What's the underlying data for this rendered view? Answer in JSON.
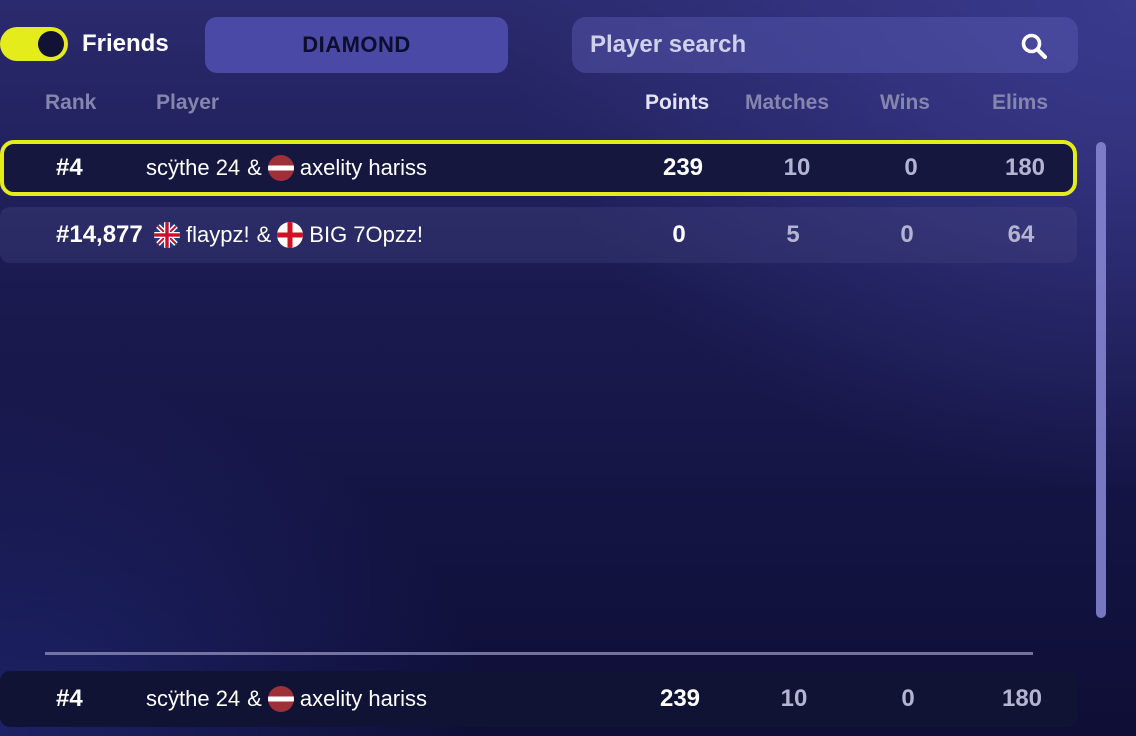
{
  "filters": {
    "friends_label": "Friends",
    "friends_toggle_on": true,
    "tier_label": "DIAMOND",
    "search_placeholder": "Player search"
  },
  "columns": {
    "rank": "Rank",
    "player": "Player",
    "points": "Points",
    "matches": "Matches",
    "wins": "Wins",
    "elims": "Elims"
  },
  "rows": [
    {
      "rank": "#4",
      "player_a": "scÿthe 24",
      "flag_a": "",
      "joiner": "&",
      "flag_b": "latvia-flag-icon",
      "player_b": "axelity hariss",
      "points": "239",
      "matches": "10",
      "wins": "0",
      "elims": "180",
      "highlighted": true
    },
    {
      "rank": "#14,877",
      "flag_a": "uk-flag-icon",
      "player_a": "flaypz!",
      "joiner": "&",
      "flag_b": "england-flag-icon",
      "player_b": "BIG 7Opzz!",
      "points": "0",
      "matches": "5",
      "wins": "0",
      "elims": "64",
      "highlighted": false
    }
  ],
  "pinned_row": {
    "rank": "#4",
    "player_a": "scÿthe 24",
    "joiner": "&",
    "flag_b": "latvia-flag-icon",
    "player_b": "axelity hariss",
    "points": "239",
    "matches": "10",
    "wins": "0",
    "elims": "180"
  },
  "colors": {
    "accent": "#e4ec1c",
    "tier_button": "#4a4aa6",
    "background": "#1a1a50"
  }
}
